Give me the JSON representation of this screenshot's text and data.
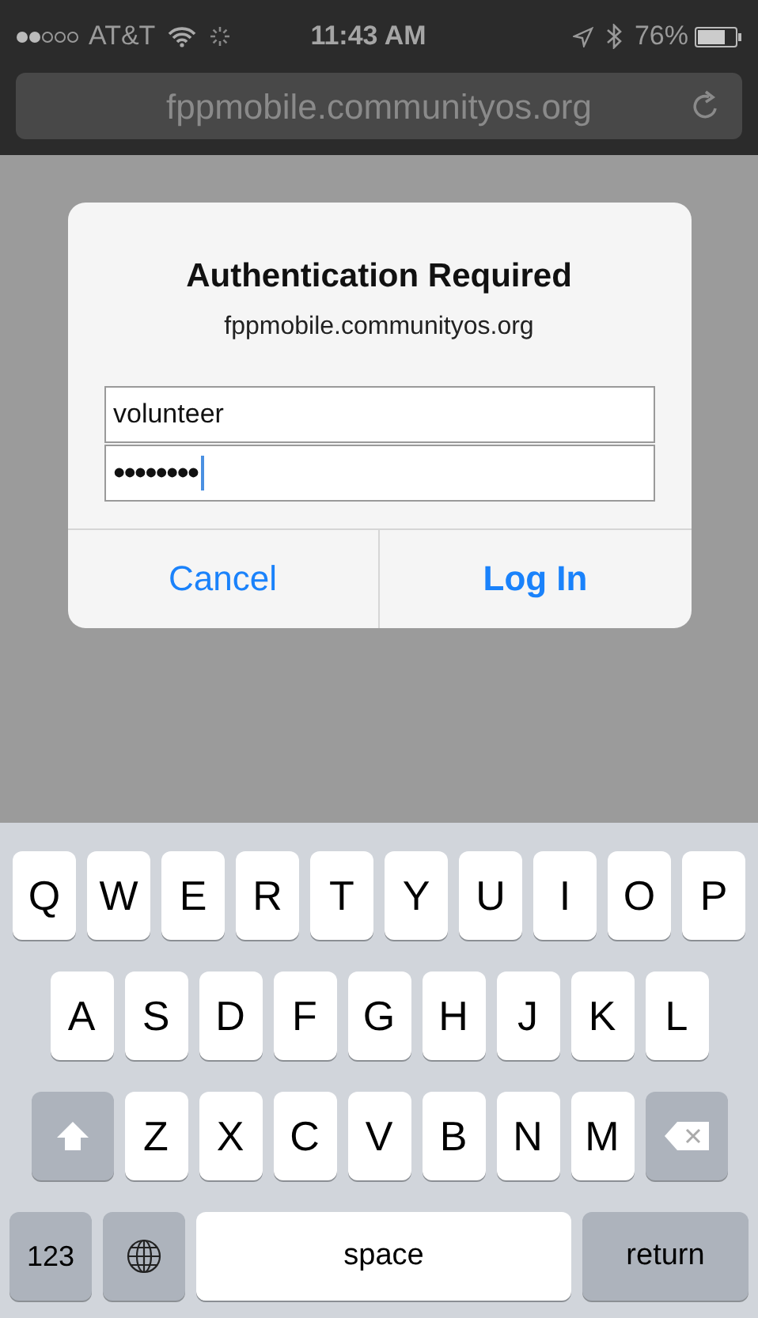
{
  "status_bar": {
    "carrier": "AT&T",
    "time": "11:43 AM",
    "battery": "76%"
  },
  "address_bar": {
    "url": "fppmobile.communityos.org"
  },
  "dialog": {
    "title": "Authentication Required",
    "subtitle": "fppmobile.communityos.org",
    "fields": [
      {
        "kind": "text",
        "value": "volunteer",
        "focused": false
      },
      {
        "kind": "password",
        "value": "••••••••",
        "focused": true
      }
    ],
    "buttons": [
      {
        "label": "Cancel",
        "default": false
      },
      {
        "label": "Log In",
        "default": true
      }
    ]
  },
  "keyboard": {
    "rows": [
      {
        "keys": [
          {
            "kind": "letter",
            "label": "Q"
          },
          {
            "kind": "letter",
            "label": "W"
          },
          {
            "kind": "letter",
            "label": "E"
          },
          {
            "kind": "letter",
            "label": "R"
          },
          {
            "kind": "letter",
            "label": "T"
          },
          {
            "kind": "letter",
            "label": "Y"
          },
          {
            "kind": "letter",
            "label": "U"
          },
          {
            "kind": "letter",
            "label": "I"
          },
          {
            "kind": "letter",
            "label": "O"
          },
          {
            "kind": "letter",
            "label": "P"
          }
        ]
      },
      {
        "keys": [
          {
            "kind": "letter",
            "label": "A"
          },
          {
            "kind": "letter",
            "label": "S"
          },
          {
            "kind": "letter",
            "label": "D"
          },
          {
            "kind": "letter",
            "label": "F"
          },
          {
            "kind": "letter",
            "label": "G"
          },
          {
            "kind": "letter",
            "label": "H"
          },
          {
            "kind": "letter",
            "label": "J"
          },
          {
            "kind": "letter",
            "label": "K"
          },
          {
            "kind": "letter",
            "label": "L"
          }
        ]
      },
      {
        "keys": [
          {
            "kind": "shift"
          },
          {
            "kind": "letter",
            "label": "Z"
          },
          {
            "kind": "letter",
            "label": "X"
          },
          {
            "kind": "letter",
            "label": "C"
          },
          {
            "kind": "letter",
            "label": "V"
          },
          {
            "kind": "letter",
            "label": "B"
          },
          {
            "kind": "letter",
            "label": "N"
          },
          {
            "kind": "letter",
            "label": "M"
          },
          {
            "kind": "delete"
          }
        ]
      },
      {
        "keys": [
          {
            "kind": "numbers",
            "label": "123"
          },
          {
            "kind": "globe"
          },
          {
            "kind": "space",
            "label": "space"
          },
          {
            "kind": "return",
            "label": "return"
          }
        ]
      }
    ]
  }
}
